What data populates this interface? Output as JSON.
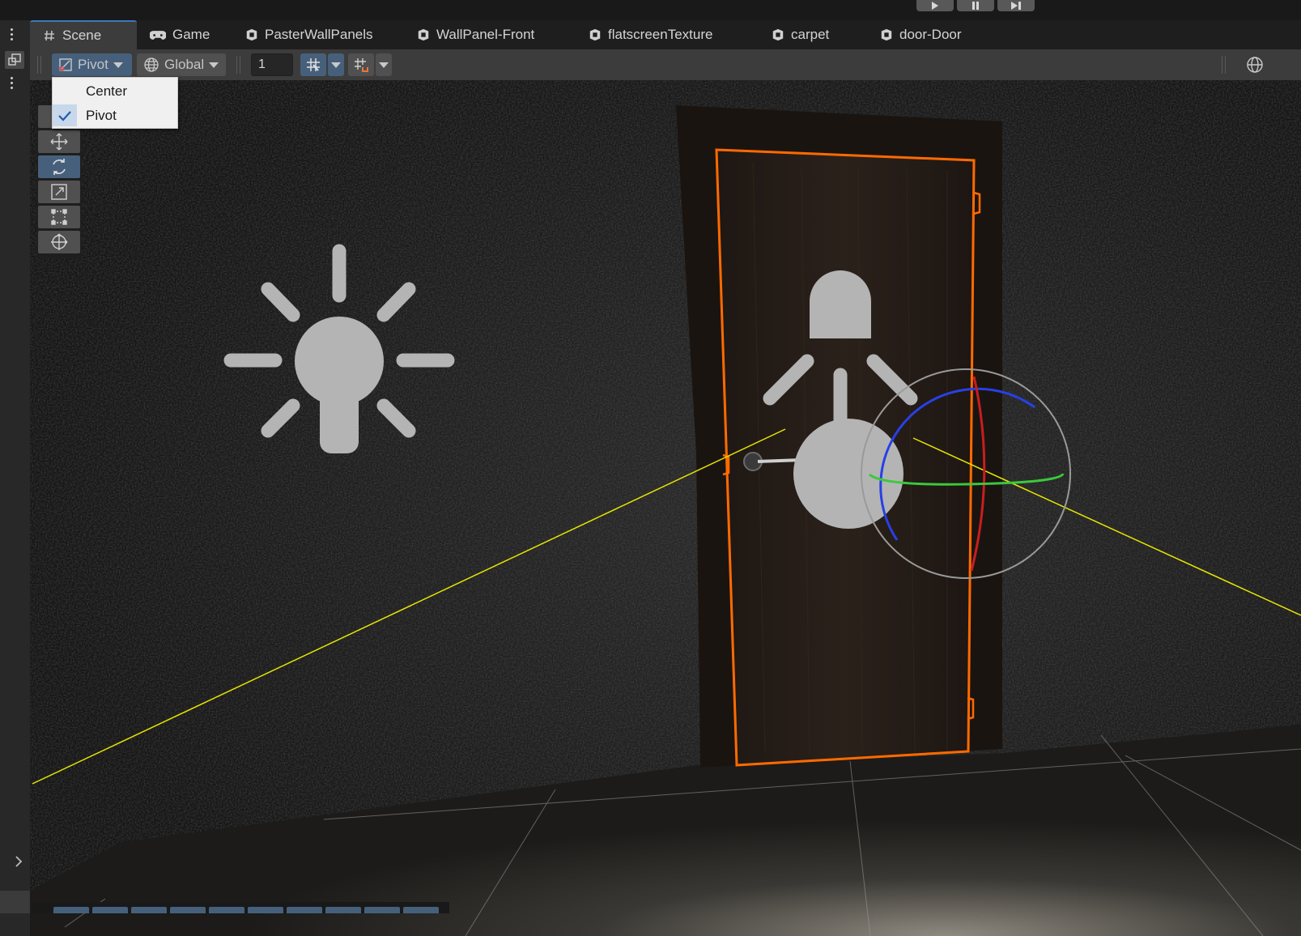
{
  "tabs": [
    {
      "label": "Scene",
      "icon": "hash-icon",
      "active": true
    },
    {
      "label": "Game",
      "icon": "gamepad-icon"
    },
    {
      "label": "PasterWallPanels",
      "icon": "prefab-icon"
    },
    {
      "label": "WallPanel-Front",
      "icon": "prefab-icon"
    },
    {
      "label": "flatscreenTexture",
      "icon": "prefab-icon"
    },
    {
      "label": "carpet",
      "icon": "prefab-icon"
    },
    {
      "label": "door-Door",
      "icon": "prefab-icon"
    }
  ],
  "toolbar": {
    "pivot_label": "Pivot",
    "space_label": "Global",
    "snap_increment": "1"
  },
  "pivot_menu": {
    "items": [
      {
        "label": "Center",
        "checked": false
      },
      {
        "label": "Pivot",
        "checked": true
      }
    ]
  },
  "tools": [
    "view-tool",
    "move-tool",
    "rotate-tool",
    "scale-tool",
    "rect-tool",
    "transform-tool"
  ],
  "selected_tool": "rotate-tool",
  "colors": {
    "selection_outline": "#ff6a00",
    "accent": "#46607c",
    "tab_underline": "#3a79bb",
    "light_gizmo": "#b4b4b4",
    "x_axis": "#c81e1e",
    "y_axis": "#3cc83c",
    "z_axis": "#2840e6",
    "light_ray": "#e6e600"
  }
}
